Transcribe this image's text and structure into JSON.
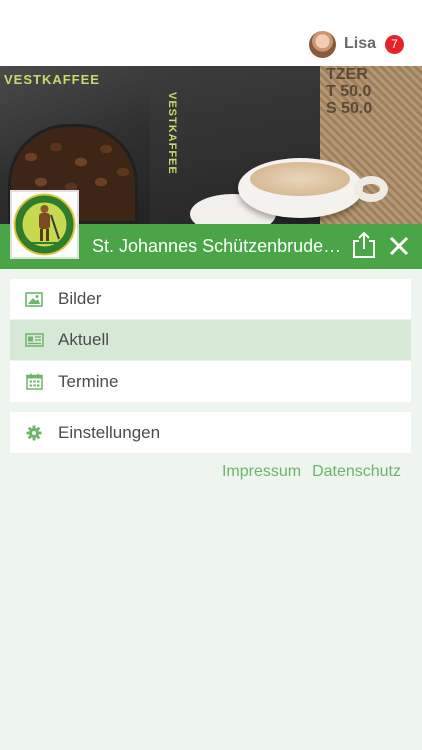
{
  "user": {
    "name": "Lisa",
    "notification_count": "7"
  },
  "hero": {
    "bag_text_1": "VESTKAFFEE",
    "bag_text_2": "VESTKAFFEE",
    "sack_text": "TZER\nT 50.0\nS 50.0"
  },
  "club": {
    "title": "St. Johannes Schützenbruderschaft"
  },
  "menu": {
    "items": [
      {
        "label": "Bilder",
        "icon": "image-icon"
      },
      {
        "label": "Aktuell",
        "icon": "news-icon",
        "active": true
      },
      {
        "label": "Termine",
        "icon": "calendar-icon"
      }
    ],
    "settings": {
      "label": "Einstellungen",
      "icon": "gear-icon"
    }
  },
  "footer": {
    "impressum": "Impressum",
    "datenschutz": "Datenschutz"
  },
  "colors": {
    "brand_green": "#49a546",
    "active_row": "#d6e9d6",
    "link_green": "#6eb56b",
    "badge_red": "#e5232b",
    "background": "#eef5ee"
  }
}
